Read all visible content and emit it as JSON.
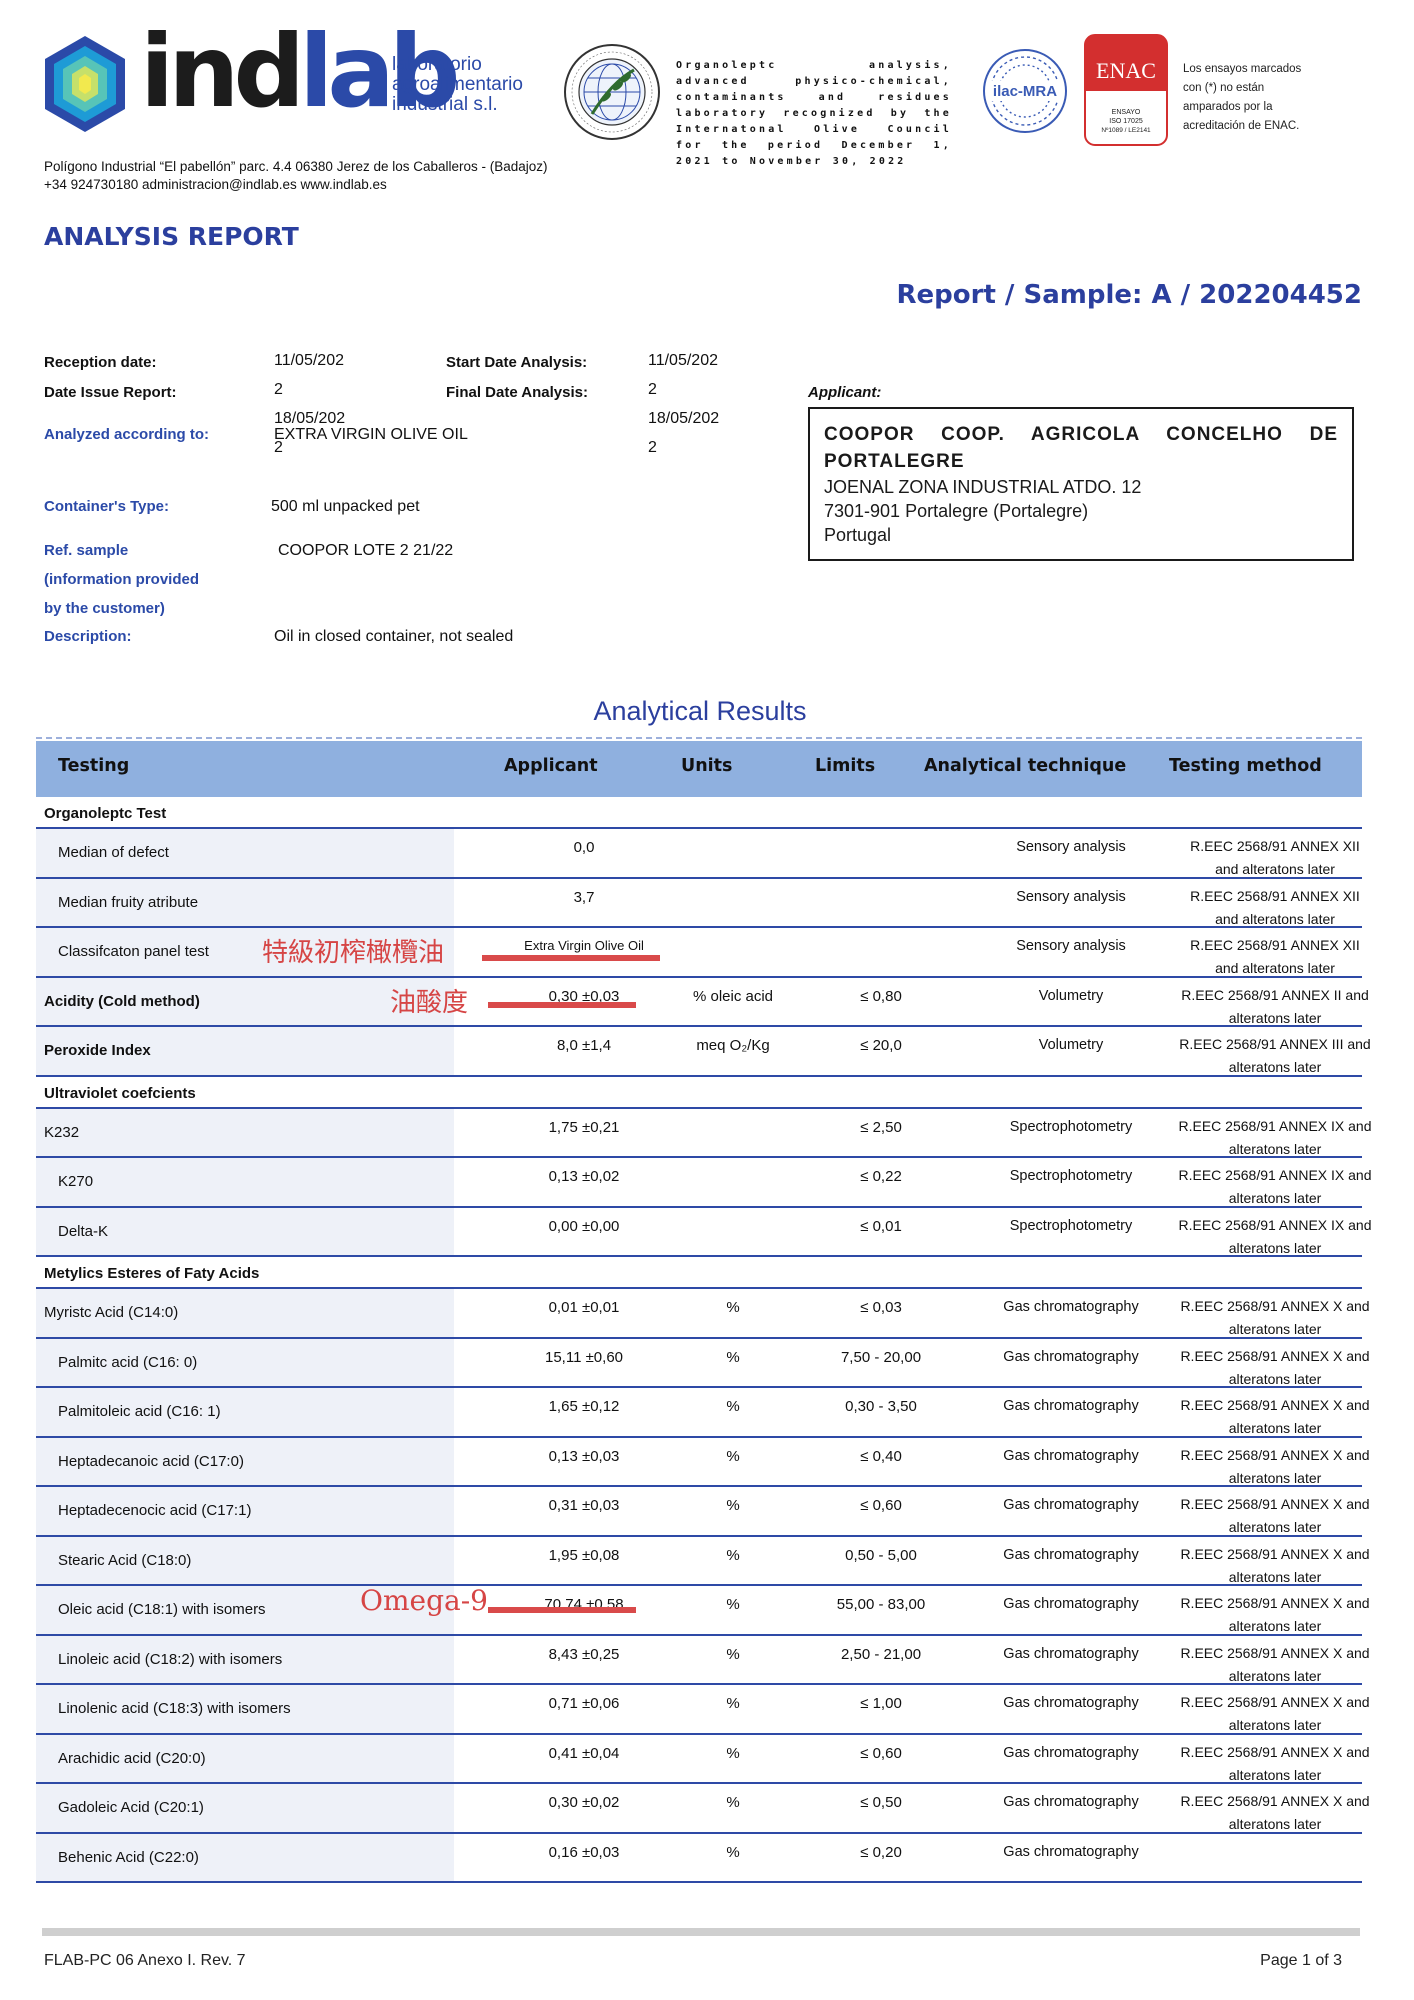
{
  "header": {
    "logo_word_main": "ind",
    "logo_word_accent": "lab",
    "logo_sub": [
      "laboratorio",
      "agroalimentario",
      "industrial s.l."
    ],
    "ioc_text": "Organoleptc analysis, advanced physico-chemical, contaminants and residues laboratory recognized by the Internatonal Olive Council for the period December 1, 2021 to November 30, 2022",
    "ilac_label": "ilac-MRA",
    "enac_label": "ENAC",
    "enac_small": [
      "ENSAYO",
      "ISO 17025",
      "Nº1089 / LE2141"
    ],
    "enac_note": "Los ensayos marcados con (*) no están amparados por la acreditación de ENAC.",
    "address_line1": "Polígono Industrial “El pabellón” parc. 4.4 06380 Jerez de los Caballeros - (Badajoz)",
    "address_line2": "+34 924730180 administracion@indlab.es www.indlab.es"
  },
  "report": {
    "title": "ANALYSIS REPORT",
    "sample": "Report / Sample: A / 202204452"
  },
  "info": {
    "reception_label": "Reception date:",
    "reception_value": "11/05/202\n2",
    "issue_label": "Date Issue Report:",
    "issue_value": "18/05/202\n2",
    "start_label": "Start Date Analysis:",
    "start_value": "11/05/202\n2",
    "final_label": "Final Date Analysis:",
    "final_value": "18/05/202\n2",
    "analyzed_label": "Analyzed according to:",
    "analyzed_value": "EXTRA VIRGIN OLIVE OIL",
    "container_label": "Container's Type:",
    "container_value": "500 ml unpacked pet",
    "ref_label": "Ref. sample\n(information provided\nby the customer)",
    "ref_value": "COOPOR LOTE 2 21/22",
    "desc_label": "Description:",
    "desc_value": "Oil in closed container, not sealed"
  },
  "applicant": {
    "label": "Applicant:",
    "name": "COOPOR COOP. AGRICOLA CONCELHO DE PORTALEGRE",
    "address1": "JOENAL ZONA INDUSTRIAL ATDO. 12",
    "address2": "7301-901 Portalegre (Portalegre)",
    "country": "Portugal"
  },
  "results": {
    "title": "Analytical Results",
    "headers": {
      "testing": "Testing",
      "applicant": "Applicant",
      "units": "Units",
      "limits": "Limits",
      "technique": "Analytical technique",
      "method": "Testing method"
    },
    "sections": [
      {
        "title": "Organoleptc Test",
        "rows": [
          {
            "name": "Median of defect",
            "indent": true,
            "bold": false,
            "applicant": "0,0",
            "units": "",
            "limits": "",
            "technique": "Sensory analysis",
            "method": "R.EEC 2568/91 ANNEX XII\nand alteratons later"
          },
          {
            "name": "Median fruity atribute",
            "indent": true,
            "bold": false,
            "applicant": "3,7",
            "units": "",
            "limits": "",
            "technique": "Sensory analysis",
            "method": "R.EEC 2568/91 ANNEX XII\nand alteratons later"
          },
          {
            "name": "Classifcaton panel test",
            "indent": true,
            "bold": false,
            "applicant": "Extra Virgin Olive Oil",
            "units": "",
            "limits": "",
            "technique": "Sensory analysis",
            "method": "R.EEC 2568/91 ANNEX XII\nand alteratons later"
          },
          {
            "name": "Acidity (Cold method)",
            "indent": false,
            "bold": true,
            "applicant": "0,30 ±0,03",
            "units": "% oleic acid",
            "limits": "≤ 0,80",
            "technique": "Volumetry",
            "method": "R.EEC 2568/91 ANNEX II and\nalteratons later"
          },
          {
            "name": "Peroxide Index",
            "indent": false,
            "bold": true,
            "applicant": "8,0 ±1,4",
            "units": "meq O₂/Kg",
            "limits": "≤ 20,0",
            "technique": "Volumetry",
            "method": "R.EEC 2568/91 ANNEX III and\nalteratons later"
          }
        ]
      },
      {
        "title": "Ultraviolet coefcients",
        "rows": [
          {
            "name": "K232",
            "indent": false,
            "bold": false,
            "applicant": "1,75 ±0,21",
            "units": "",
            "limits": "≤ 2,50",
            "technique": "Spectrophotometry",
            "method": "R.EEC 2568/91 ANNEX IX and\nalteratons later"
          },
          {
            "name": "K270",
            "indent": true,
            "bold": false,
            "applicant": "0,13 ±0,02",
            "units": "",
            "limits": "≤ 0,22",
            "technique": "Spectrophotometry",
            "method": "R.EEC 2568/91 ANNEX IX and\nalteratons later"
          },
          {
            "name": "Delta-K",
            "indent": true,
            "bold": false,
            "applicant": "0,00 ±0,00",
            "units": "",
            "limits": "≤ 0,01",
            "technique": "Spectrophotometry",
            "method": "R.EEC 2568/91 ANNEX IX and\nalteratons later"
          }
        ]
      },
      {
        "title": "Metylics Esteres of Faty Acids",
        "rows": [
          {
            "name": "Myristc Acid (C14:0)",
            "indent": false,
            "bold": false,
            "applicant": "0,01 ±0,01",
            "units": "%",
            "limits": "≤ 0,03",
            "technique": "Gas chromatography",
            "method": "R.EEC 2568/91 ANNEX X and\nalteratons later"
          },
          {
            "name": "Palmitc acid (C16: 0)",
            "indent": true,
            "bold": false,
            "applicant": "15,11 ±0,60",
            "units": "%",
            "limits": "7,50 - 20,00",
            "technique": "Gas chromatography",
            "method": "R.EEC 2568/91 ANNEX X and\nalteratons later"
          },
          {
            "name": "Palmitoleic acid (C16: 1)",
            "indent": true,
            "bold": false,
            "applicant": "1,65 ±0,12",
            "units": "%",
            "limits": "0,30 - 3,50",
            "technique": "Gas chromatography",
            "method": "R.EEC 2568/91 ANNEX X and\nalteratons later"
          },
          {
            "name": "Heptadecanoic acid (C17:0)",
            "indent": true,
            "bold": false,
            "applicant": "0,13 ±0,03",
            "units": "%",
            "limits": "≤ 0,40",
            "technique": "Gas chromatography",
            "method": "R.EEC 2568/91 ANNEX X and\nalteratons later"
          },
          {
            "name": "Heptadecenocic acid (C17:1)",
            "indent": true,
            "bold": false,
            "applicant": "0,31 ±0,03",
            "units": "%",
            "limits": "≤ 0,60",
            "technique": "Gas chromatography",
            "method": "R.EEC 2568/91 ANNEX X and\nalteratons later"
          },
          {
            "name": "Stearic Acid (C18:0)",
            "indent": true,
            "bold": false,
            "applicant": "1,95 ±0,08",
            "units": "%",
            "limits": "0,50 - 5,00",
            "technique": "Gas chromatography",
            "method": "R.EEC 2568/91 ANNEX X and\nalteratons later"
          },
          {
            "name": "Oleic acid (C18:1) with isomers",
            "indent": true,
            "bold": false,
            "applicant": "70,74 ±0,58",
            "units": "%",
            "limits": "55,00 - 83,00",
            "technique": "Gas chromatography",
            "method": "R.EEC 2568/91 ANNEX X and\nalteratons later"
          },
          {
            "name": "Linoleic acid (C18:2) with isomers",
            "indent": true,
            "bold": false,
            "applicant": "8,43 ±0,25",
            "units": "%",
            "limits": "2,50 - 21,00",
            "technique": "Gas chromatography",
            "method": "R.EEC 2568/91 ANNEX X and\nalteratons later"
          },
          {
            "name": "Linolenic acid (C18:3) with isomers",
            "indent": true,
            "bold": false,
            "applicant": "0,71 ±0,06",
            "units": "%",
            "limits": "≤ 1,00",
            "technique": "Gas chromatography",
            "method": "R.EEC 2568/91 ANNEX X and\nalteratons later"
          },
          {
            "name": "Arachidic acid (C20:0)",
            "indent": true,
            "bold": false,
            "applicant": "0,41 ±0,04",
            "units": "%",
            "limits": "≤ 0,60",
            "technique": "Gas chromatography",
            "method": "R.EEC 2568/91 ANNEX X and\nalteratons later"
          },
          {
            "name": "Gadoleic Acid (C20:1)",
            "indent": true,
            "bold": false,
            "applicant": "0,30 ±0,02",
            "units": "%",
            "limits": "≤ 0,50",
            "technique": "Gas chromatography",
            "method": "R.EEC 2568/91 ANNEX X and\nalteratons later"
          },
          {
            "name": "Behenic Acid (C22:0)",
            "indent": true,
            "bold": false,
            "applicant": "0,16 ±0,03",
            "units": "%",
            "limits": "≤ 0,20",
            "technique": "Gas chromatography",
            "method": ""
          }
        ]
      }
    ]
  },
  "annotations": {
    "evoo": "特級初榨橄欖油",
    "acidity": "油酸度",
    "omega": "Omega-9",
    "color": "#d64545"
  },
  "footer": {
    "form_code": "FLAB-PC 06 Anexo I. Rev. 7",
    "page": "Page 1 of 3"
  }
}
